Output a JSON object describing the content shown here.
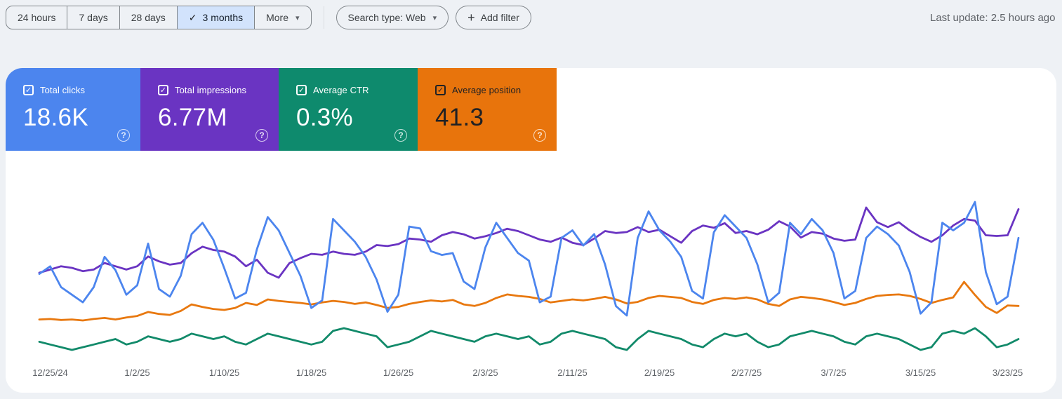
{
  "icons": {
    "check": "✓",
    "dropdown": "▾",
    "plus": "+",
    "help": "?"
  },
  "toolbar": {
    "date_ranges": [
      {
        "label": "24 hours",
        "selected": false
      },
      {
        "label": "7 days",
        "selected": false
      },
      {
        "label": "28 days",
        "selected": false
      },
      {
        "label": "3 months",
        "selected": true
      },
      {
        "label": "More",
        "selected": false
      }
    ],
    "search_type": "Search type: Web",
    "add_filter": "Add filter",
    "last_update": "Last update: 2.5 hours ago"
  },
  "metrics": [
    {
      "label": "Total clicks",
      "value": "18.6K",
      "color": "#4c85ee",
      "text_color": "#ffffff",
      "checked": true
    },
    {
      "label": "Total impressions",
      "value": "6.77M",
      "color": "#6a34c2",
      "text_color": "#ffffff",
      "checked": true
    },
    {
      "label": "Average CTR",
      "value": "0.3%",
      "color": "#0e8a6d",
      "text_color": "#ffffff",
      "checked": true
    },
    {
      "label": "Average position",
      "value": "41.3",
      "color": "#e8740c",
      "text_color": "#202124",
      "checked": true
    }
  ],
  "chart_data": {
    "type": "line",
    "title": "Search performance over 3 months (daily values, estimated from plot; no y-axis shown)",
    "xlabel": "",
    "ylabel": "",
    "grid": false,
    "legend_position": "none",
    "x_range": [
      "12/24/24",
      "3/24/25"
    ],
    "tick_indices": [
      1,
      9,
      17,
      25,
      33,
      41,
      49,
      57,
      65,
      73,
      81,
      89
    ],
    "x_tick_labels": [
      "12/25/24",
      "1/2/25",
      "1/10/25",
      "1/18/25",
      "1/26/25",
      "2/3/25",
      "2/11/25",
      "2/19/25",
      "2/27/25",
      "3/7/25",
      "3/15/25",
      "3/23/25"
    ],
    "series": [
      {
        "name": "Clicks",
        "color": "#4c85ee",
        "unit": "clicks/day (est.)",
        "band": [
          38,
          200
        ],
        "z": 1,
        "values": [
          195,
          215,
          160,
          140,
          120,
          160,
          240,
          205,
          140,
          165,
          275,
          155,
          135,
          190,
          300,
          330,
          285,
          210,
          130,
          145,
          260,
          345,
          310,
          250,
          190,
          105,
          125,
          340,
          310,
          280,
          240,
          180,
          95,
          140,
          320,
          315,
          255,
          245,
          250,
          175,
          155,
          265,
          330,
          290,
          250,
          230,
          120,
          135,
          290,
          310,
          270,
          300,
          220,
          110,
          85,
          290,
          360,
          310,
          280,
          240,
          150,
          130,
          305,
          350,
          320,
          290,
          220,
          120,
          145,
          330,
          300,
          340,
          310,
          250,
          130,
          150,
          290,
          320,
          300,
          270,
          200,
          90,
          120,
          330,
          310,
          330,
          385,
          200,
          115,
          135,
          290
        ]
      },
      {
        "name": "Impressions",
        "color": "#6a34c2",
        "unit": "thousand impressions/day (est.)",
        "band": [
          46,
          146
        ],
        "z": 0,
        "values": [
          68,
          69,
          70,
          69.5,
          68.5,
          69,
          71,
          70,
          69,
          70,
          73,
          71.5,
          70.5,
          71,
          74,
          76,
          75,
          74.5,
          73,
          70,
          72,
          68,
          66.5,
          71,
          72.5,
          73.8,
          73.5,
          74.5,
          73.8,
          73.5,
          74.5,
          76.5,
          76.2,
          76.8,
          78.5,
          78.2,
          77.5,
          79.5,
          80.5,
          79.8,
          78.5,
          79.2,
          80.2,
          81.5,
          80.8,
          79.5,
          78.2,
          77.5,
          78.8,
          77.2,
          76.5,
          78.5,
          80.8,
          80.2,
          80.5,
          82,
          80.5,
          81.2,
          79.2,
          77.2,
          80.8,
          82.5,
          81.8,
          83.2,
          80.2,
          80.8,
          79.8,
          81.2,
          83.8,
          82.2,
          78.8,
          80.5,
          80,
          78.5,
          77.8,
          78.2,
          88,
          83.5,
          82,
          83.5,
          81,
          79,
          77.5,
          79.5,
          82.5,
          84.5,
          84,
          79.5,
          79.3,
          79.5,
          87.5
        ]
      },
      {
        "name": "CTR",
        "color": "#128a6a",
        "unit": "% (est.)",
        "band": [
          218,
          249
        ],
        "z": 0,
        "values": [
          0.28,
          0.27,
          0.26,
          0.25,
          0.26,
          0.27,
          0.28,
          0.29,
          0.27,
          0.28,
          0.3,
          0.29,
          0.28,
          0.29,
          0.31,
          0.3,
          0.29,
          0.3,
          0.28,
          0.27,
          0.29,
          0.31,
          0.3,
          0.29,
          0.28,
          0.27,
          0.28,
          0.32,
          0.33,
          0.32,
          0.31,
          0.3,
          0.26,
          0.27,
          0.28,
          0.3,
          0.32,
          0.31,
          0.3,
          0.29,
          0.28,
          0.3,
          0.31,
          0.3,
          0.29,
          0.3,
          0.27,
          0.28,
          0.31,
          0.32,
          0.31,
          0.3,
          0.29,
          0.26,
          0.25,
          0.29,
          0.32,
          0.31,
          0.3,
          0.29,
          0.27,
          0.26,
          0.29,
          0.31,
          0.3,
          0.31,
          0.28,
          0.26,
          0.27,
          0.3,
          0.31,
          0.32,
          0.31,
          0.3,
          0.28,
          0.27,
          0.3,
          0.31,
          0.3,
          0.29,
          0.27,
          0.25,
          0.26,
          0.31,
          0.32,
          0.31,
          0.33,
          0.3,
          0.26,
          0.27,
          0.29
        ]
      },
      {
        "name": "Position",
        "color": "#e8780f",
        "unit": "avg position (est.)",
        "band": [
          152,
          207
        ],
        "z": 0,
        "values": [
          37.5,
          37.6,
          37.4,
          37.5,
          37.3,
          37.6,
          37.8,
          37.5,
          37.9,
          38.2,
          39.0,
          38.6,
          38.4,
          39.2,
          40.5,
          40.0,
          39.6,
          39.4,
          39.8,
          40.8,
          40.4,
          41.5,
          41.2,
          41.0,
          40.8,
          40.5,
          40.9,
          41.2,
          41.0,
          40.6,
          40.9,
          40.4,
          39.8,
          40.0,
          40.6,
          41.0,
          41.3,
          41.1,
          41.4,
          40.5,
          40.2,
          40.8,
          41.8,
          42.5,
          42.2,
          42.0,
          41.6,
          40.9,
          41.2,
          41.5,
          41.3,
          41.6,
          42.0,
          41.5,
          40.7,
          41.0,
          41.8,
          42.2,
          42.0,
          41.8,
          41.0,
          40.6,
          41.4,
          41.8,
          41.6,
          41.9,
          41.5,
          40.6,
          40.2,
          41.5,
          42.0,
          41.8,
          41.5,
          41.0,
          40.4,
          40.8,
          41.6,
          42.2,
          42.4,
          42.5,
          42.2,
          41.6,
          40.8,
          41.4,
          41.9,
          45.0,
          42.4,
          40.0,
          38.8,
          40.3,
          40.2
        ]
      }
    ]
  }
}
